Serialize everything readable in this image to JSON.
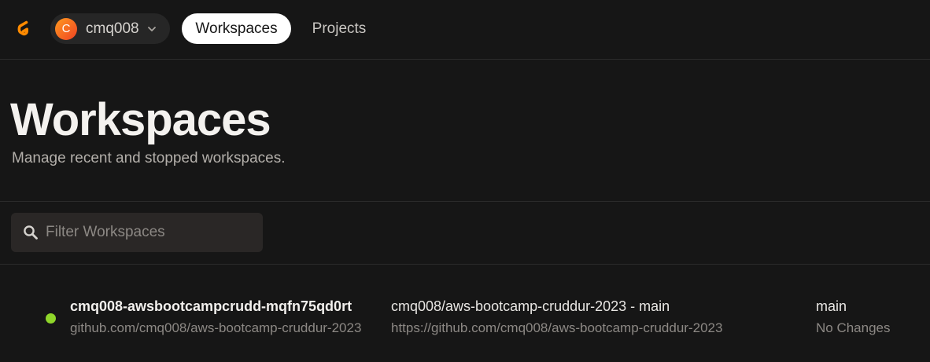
{
  "topbar": {
    "account": {
      "avatar_letter": "C",
      "name": "cmq008"
    },
    "nav": [
      {
        "label": "Workspaces",
        "active": true
      },
      {
        "label": "Projects",
        "active": false
      }
    ]
  },
  "header": {
    "title": "Workspaces",
    "subtitle": "Manage recent and stopped workspaces."
  },
  "filter": {
    "placeholder": "Filter Workspaces",
    "value": ""
  },
  "workspaces": [
    {
      "status": "running",
      "status_color": "#8fd62a",
      "name": "cmq008-awsbootcampcrudd-mqfn75qd0rt",
      "repo": "github.com/cmq008/aws-bootcamp-cruddur-2023",
      "context": "cmq008/aws-bootcamp-cruddur-2023 - main",
      "context_url": "https://github.com/cmq008/aws-bootcamp-cruddur-2023",
      "branch": "main",
      "changes": "No Changes"
    }
  ],
  "colors": {
    "background": "#161616",
    "accent": "#ff8a00",
    "active_tab": "#ffffff"
  },
  "icons": [
    "gitpod-logo-icon",
    "chevron-down-icon",
    "search-icon"
  ]
}
